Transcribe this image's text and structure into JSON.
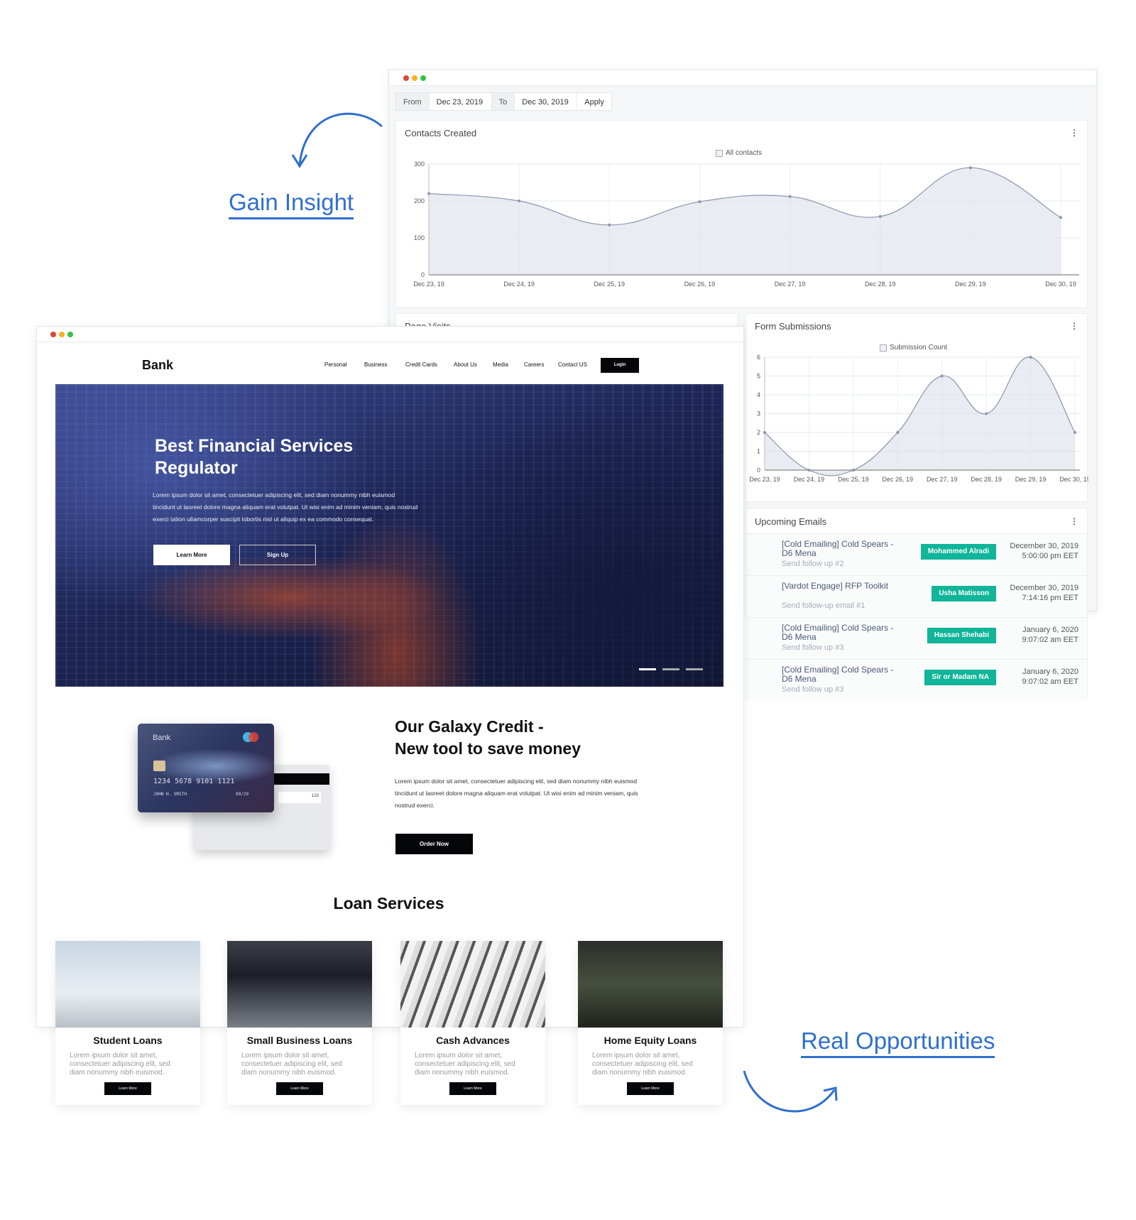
{
  "callouts": {
    "gain": "Gain Insight",
    "real": "Real Opportunities"
  },
  "dashboard": {
    "filter": {
      "from_label": "From",
      "from": "Dec 23, 2019",
      "to_label": "To",
      "to": "Dec 30, 2019",
      "apply": "Apply"
    },
    "page_visits_title": "Page Visits",
    "accent": "#10b59a"
  },
  "chart_data": [
    {
      "type": "area",
      "title": "Contacts Created",
      "legend": [
        "All contacts"
      ],
      "legend_position": "top",
      "x": [
        "Dec 23, 19",
        "Dec 24, 19",
        "Dec 25, 19",
        "Dec 26, 19",
        "Dec 27, 19",
        "Dec 28, 19",
        "Dec 29, 19",
        "Dec 30, 19"
      ],
      "series": [
        {
          "name": "All contacts",
          "values": [
            220,
            200,
            135,
            198,
            212,
            158,
            290,
            155
          ]
        }
      ],
      "yticks": [
        0,
        100,
        200,
        300
      ],
      "ylim": [
        0,
        300
      ],
      "grid": true
    },
    {
      "type": "area",
      "title": "Form Submissions",
      "legend": [
        "Submission Count"
      ],
      "legend_position": "top",
      "x": [
        "Dec 23, 19",
        "Dec 24, 19",
        "Dec 25, 19",
        "Dec 26, 19",
        "Dec 27, 19",
        "Dec 28, 19",
        "Dec 29, 19",
        "Dec 30, 19"
      ],
      "series": [
        {
          "name": "Submission Count",
          "values": [
            2,
            0,
            0,
            2,
            5,
            3,
            6,
            2
          ]
        }
      ],
      "yticks": [
        0,
        1,
        2,
        3,
        4,
        5,
        6
      ],
      "ylim": [
        0,
        6
      ],
      "grid": true
    }
  ],
  "emails": {
    "title": "Upcoming Emails",
    "items": [
      {
        "title": "[Cold Emailing] Cold Spears - D6 Mena",
        "sub": "Send follow up #2",
        "who": "Mohammed Alradi",
        "date": "December 30, 2019",
        "time": "5:00:00 pm EET"
      },
      {
        "title": "[Vardot Engage] RFP Toolkit",
        "sub": "Send follow-up email #1",
        "who": "Usha Matisson",
        "date": "December 30, 2019",
        "time": "7:14:16 pm EET"
      },
      {
        "title": "[Cold Emailing] Cold Spears - D6 Mena",
        "sub": "Send follow up #3",
        "who": "Hassan Shehabi",
        "date": "January 6, 2020",
        "time": "9:07:02 am EET"
      },
      {
        "title": "[Cold Emailing] Cold Spears - D6 Mena",
        "sub": "Send follow up #3",
        "who": "Sir or Madam NA",
        "date": "January 6, 2020",
        "time": "9:07:02 am EET"
      }
    ]
  },
  "bank": {
    "logo": "Bank",
    "nav": [
      "Personal",
      "Business",
      "Credit Cards",
      "About Us",
      "Media",
      "Careers",
      "Contact US"
    ],
    "login": "Login",
    "hero": {
      "title1": "Best Financial Services",
      "title2": "Regulator",
      "body": "Lorem ipsum dolor sit amet, consectetuer adipiscing elit, sed diam nonummy nibh euismod tincidunt ut laoreet dolore magna aliquam erat volutpat. Ut wisi enim ad minim veniam, quis nostrud exerci tation ullamcorper suscipit lobortis nisl ut aliquip ex ea commodo consequat.",
      "learn": "Learn More",
      "signup": "Sign Up"
    },
    "credit": {
      "card_bank": "Bank",
      "card_number": "1234  5678  9101  1121",
      "card_name": "JOHN H. SMITH",
      "card_exp": "09/29",
      "cvv": "123",
      "title1": "Our Galaxy Credit -",
      "title2": "New tool to save money",
      "body": "Lorem ipsum dolor sit amet, consectetuer adipiscing elit, sed diam nonummy nibh euismod tincidunt ut laoreet dolore magna aliquam erat volutpat. Ut wisi enim ad minim veniam, quis nostrud exerci.",
      "order": "Order Now"
    },
    "loans_title": "Loan Services",
    "loans": [
      {
        "title": "Student Loans",
        "body": "Lorem ipsum dolor sit amet, consectetuer adipiscing elit, sed diam nonummy nibh euismod.",
        "btn": "Learn More"
      },
      {
        "title": "Small Business Loans",
        "body": "Lorem ipsum dolor sit amet, consectetuer adipiscing elit, sed diam nonummy nibh euismod.",
        "btn": "Learn More"
      },
      {
        "title": "Cash Advances",
        "body": "Lorem ipsum dolor sit amet, consectetuer adipiscing elit, sed diam nonummy nibh euismod.",
        "btn": "Learn More"
      },
      {
        "title": "Home Equity Loans",
        "body": "Lorem ipsum dolor sit amet, consectetuer adipiscing elit, sed diam nonummy nibh euismod.",
        "btn": "Learn More"
      }
    ]
  }
}
